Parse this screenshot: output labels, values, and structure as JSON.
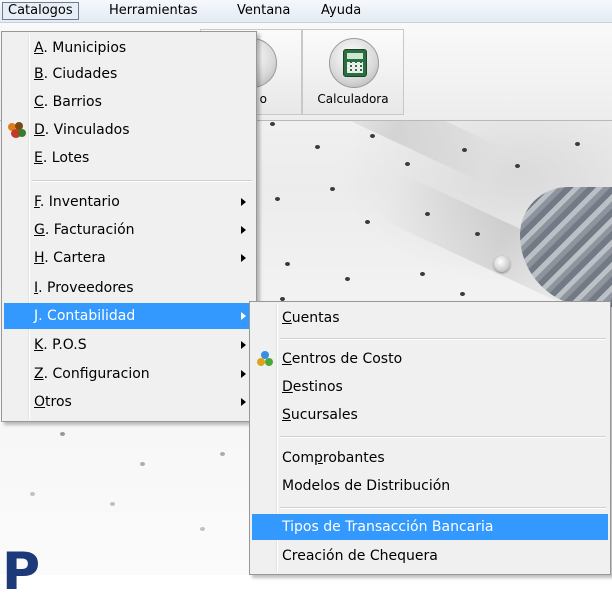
{
  "menubar": {
    "items": [
      {
        "label": "Catalogos",
        "open": true
      },
      {
        "label": "Herramientas"
      },
      {
        "label": "Ventana"
      },
      {
        "label": "Ayuda"
      }
    ]
  },
  "toolbar": {
    "partial_label": "o",
    "calculadora_label": "Calculadora"
  },
  "catalogos_menu": {
    "items": [
      {
        "key": "A",
        "rest": ". Municipios"
      },
      {
        "key": "B",
        "rest": ". Ciudades"
      },
      {
        "key": "C",
        "rest": ". Barrios"
      },
      {
        "key": "D",
        "rest": ". Vinculados",
        "icon": "people-icon"
      },
      {
        "key": "E",
        "rest": ". Lotes"
      },
      {
        "key": "F",
        "rest": ".  Inventario",
        "submenu": true
      },
      {
        "key": "G",
        "rest": ". Facturación",
        "submenu": true
      },
      {
        "key": "H",
        "rest": ". Cartera",
        "submenu": true
      },
      {
        "key": "I",
        "rest": ".  Proveedores"
      },
      {
        "key": "J",
        "rest": ". Contabilidad",
        "submenu": true,
        "highlighted": true
      },
      {
        "key": "K",
        "rest": ". P.O.S",
        "submenu": true
      },
      {
        "key": "Z",
        "rest": ". Configuracion",
        "submenu": true
      },
      {
        "key": "O",
        "rest": "tros",
        "submenu": true
      }
    ]
  },
  "contabilidad_menu": {
    "items": [
      {
        "key": "C",
        "rest": "uentas"
      },
      {
        "key": "C",
        "rest": "entros de Costo",
        "icon": "centros-costo-icon"
      },
      {
        "key": "D",
        "rest": "estinos"
      },
      {
        "key": "S",
        "rest": "ucursales"
      },
      {
        "pre": "Com",
        "key": "p",
        "rest": "robantes"
      },
      {
        "pre": "",
        "key": "",
        "rest": "Modelos de Distribución"
      },
      {
        "pre": "",
        "key": "",
        "rest": "Tipos de Transacción Bancaria",
        "highlighted": true
      },
      {
        "pre": "",
        "key": "",
        "rest": "Creación de Chequera"
      }
    ]
  },
  "wallpaper": {
    "logo_letter": "P"
  },
  "colors": {
    "highlight": "#3399ff",
    "menu_bg": "#f0f0f0"
  }
}
